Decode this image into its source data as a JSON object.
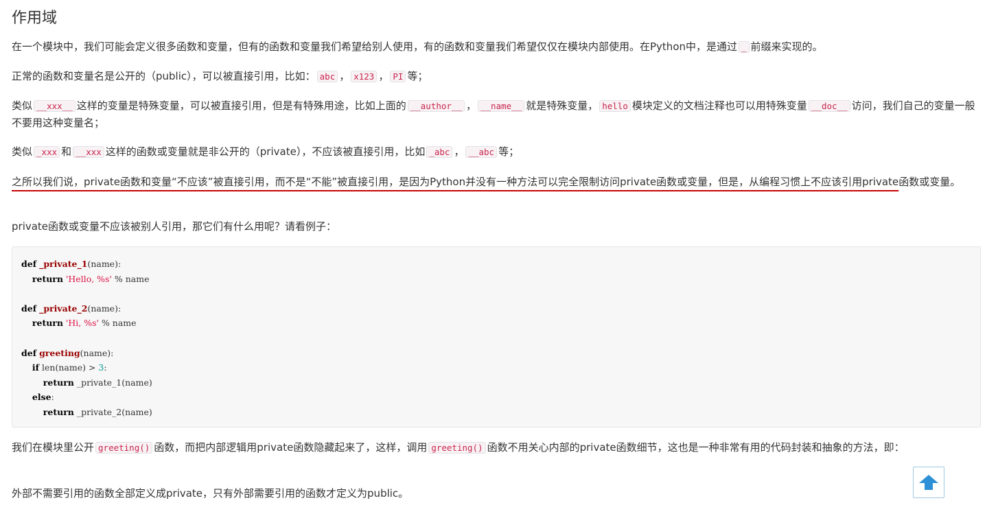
{
  "article": {
    "title": "作用域",
    "p1": {
      "before": "在一个模块中，我们可能会定义很多函数和变量，但有的函数和变量我们希望给别人使用，有的函数和变量我们希望仅仅在模块内部使用。在Python中，是通过",
      "code": "_",
      "after": "前缀来实现的。"
    },
    "p2": {
      "t1": "正常的函数和变量名是公开的（public），可以被直接引用，比如：",
      "c1": "abc",
      "t2": "，",
      "c2": "x123",
      "t3": "，",
      "c3": "PI",
      "t4": "等；"
    },
    "p3": {
      "t1": "类似",
      "c1": "__xxx__",
      "t2": "这样的变量是特殊变量，可以被直接引用，但是有特殊用途，比如上面的",
      "c2": "__author__",
      "t3": "，",
      "c3": "__name__",
      "t4": "就是特殊变量，",
      "c4": "hello",
      "t5": "模块定义的文档注释也可以用特殊变量",
      "c5": "__doc__",
      "t6": "访问，我们自己的变量一般不要用这种变量名；"
    },
    "p4": {
      "t1": "类似",
      "c1": "_xxx",
      "t2": "和",
      "c2": "__xxx",
      "t3": "这样的函数或变量就是非公开的（private），不应该被直接引用，比如",
      "c3": "_abc",
      "t4": "，",
      "c4": "__abc",
      "t5": "等；"
    },
    "p5": {
      "underlined": "之所以我们说，private函数和变量“不应该”被直接引用，而不是“不能”被直接引用，是因为Python并没有一种方法可以完全限制访问private函数或变量，但是，从编程习惯上不应该引用private",
      "rest": "函数或变量。"
    },
    "p6": "private函数或变量不应该被别人引用，那它们有什么用呢？请看例子：",
    "code": {
      "def": "def",
      "return": "return",
      "if": "if",
      "else": "else",
      "fn1": "_private_1",
      "fn2": "_private_2",
      "fn3": "greeting",
      "param": "(name):",
      "s1": "'Hello, %s'",
      "s2": "'Hi, %s'",
      "mod_name": " % name",
      "len_open": " len(name) > ",
      "three": "3",
      "colon": ":",
      "call1": " _private_1(name)",
      "call2": " _private_2(name)"
    },
    "p7": {
      "t1": "我们在模块里公开",
      "c1": "greeting()",
      "t2": "函数，而把内部逻辑用private函数隐藏起来了，这样，调用",
      "c2": "greeting()",
      "t3": "函数不用关心内部的private函数细节，这也是一种非常有用的代码封装和抽象的方法，即："
    },
    "p8": "外部不需要引用的函数全部定义成private，只有外部需要引用的函数才定义为public。"
  },
  "back_to_top": {
    "icon": "arrow-up-icon",
    "color": "#2d8fd5"
  }
}
